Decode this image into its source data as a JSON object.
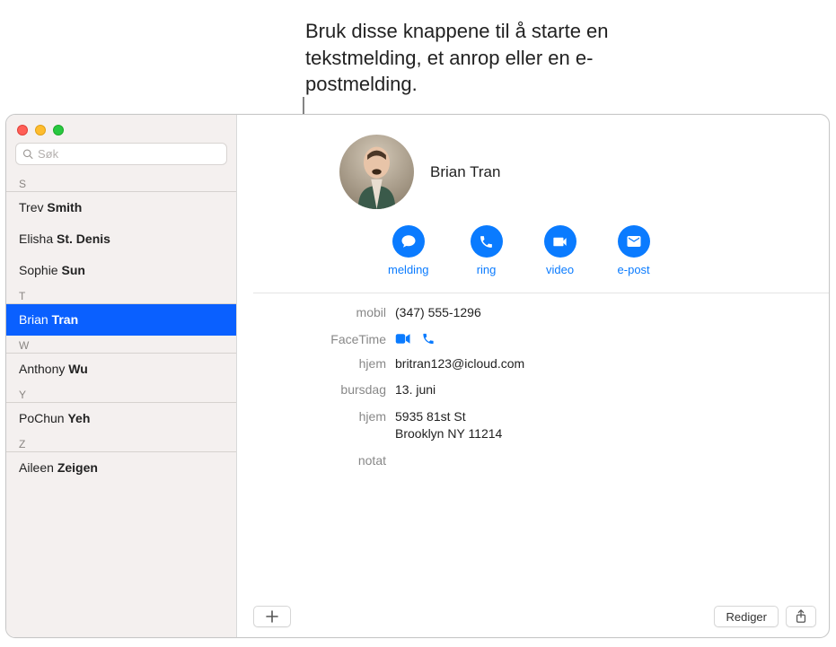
{
  "annotation": "Bruk disse knappene til å starte en tekstmelding, et anrop eller en e-postmelding.",
  "search": {
    "placeholder": "Søk"
  },
  "sections": {
    "s": {
      "label": "S",
      "items": [
        {
          "first": "Trev",
          "last": "Smith"
        },
        {
          "first": "Elisha",
          "last": "St. Denis"
        },
        {
          "first": "Sophie",
          "last": "Sun"
        }
      ]
    },
    "t": {
      "label": "T",
      "items": [
        {
          "first": "Brian",
          "last": "Tran",
          "selected": true
        }
      ]
    },
    "w": {
      "label": "W",
      "items": [
        {
          "first": "Anthony",
          "last": "Wu"
        }
      ]
    },
    "y": {
      "label": "Y",
      "items": [
        {
          "first": "PoChun",
          "last": "Yeh"
        }
      ]
    },
    "z": {
      "label": "Z",
      "items": [
        {
          "first": "Aileen",
          "last": "Zeigen"
        }
      ]
    }
  },
  "detail": {
    "name": "Brian Tran",
    "actions": {
      "message": "melding",
      "call": "ring",
      "video": "video",
      "email": "e-post"
    },
    "fields": {
      "mobile_label": "mobil",
      "mobile_value": "(347) 555-1296",
      "facetime_label": "FaceTime",
      "home_email_label": "hjem",
      "home_email_value": "britran123@icloud.com",
      "birthday_label": "bursdag",
      "birthday_value": "13. juni",
      "home_addr_label": "hjem",
      "home_addr_line1": "5935 81st St",
      "home_addr_line2": "Brooklyn NY 11214",
      "note_label": "notat"
    }
  },
  "bottom": {
    "edit": "Rediger"
  }
}
